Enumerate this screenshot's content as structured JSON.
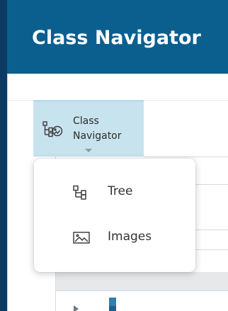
{
  "app": {
    "title": "Class Navigator"
  },
  "ribbon": {
    "button_label_line1": "Class",
    "button_label_line2": "Navigator",
    "button_icon": "class-navigator-icon"
  },
  "menu": {
    "items": [
      {
        "label": "Tree",
        "icon": "tree-icon"
      },
      {
        "label": "Images",
        "icon": "image-icon"
      }
    ]
  },
  "colors": {
    "title_bar": "#0b5f8f",
    "left_rail": "#0b3b63",
    "ribbon_button_active": "#c7e3ee"
  }
}
